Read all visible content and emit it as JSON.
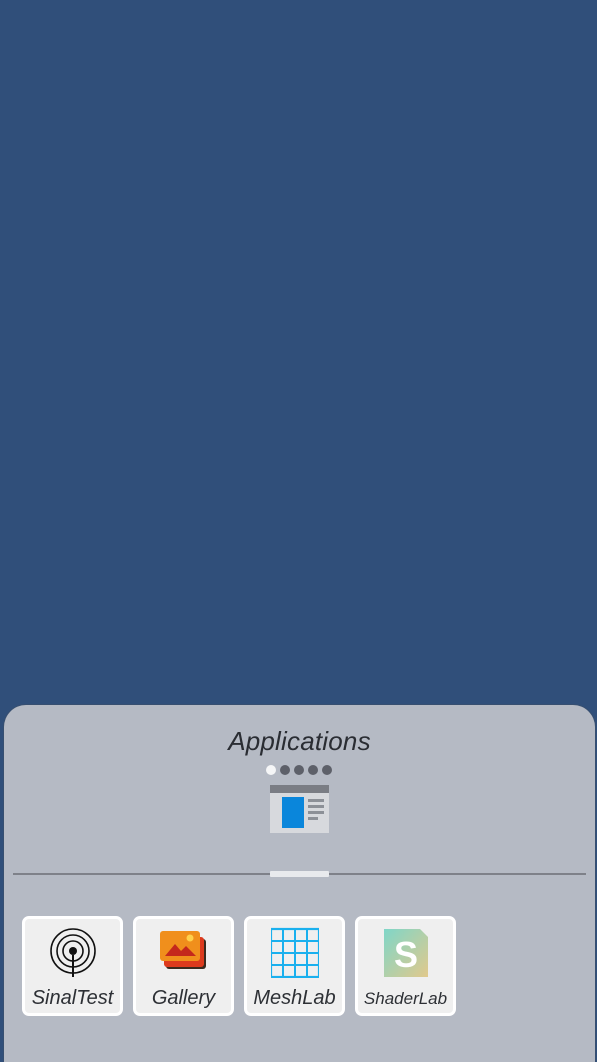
{
  "panel": {
    "title": "Applications",
    "page_count": 5,
    "active_page": 1
  },
  "apps": [
    {
      "label": "SinalTest",
      "icon": "signal-icon"
    },
    {
      "label": "Gallery",
      "icon": "gallery-icon"
    },
    {
      "label": "MeshLab",
      "icon": "grid-icon"
    },
    {
      "label": "ShaderLab",
      "icon": "shader-icon"
    }
  ],
  "colors": {
    "background": "#304f7a",
    "panel": "#b5bac4",
    "tile": "#efefef"
  }
}
